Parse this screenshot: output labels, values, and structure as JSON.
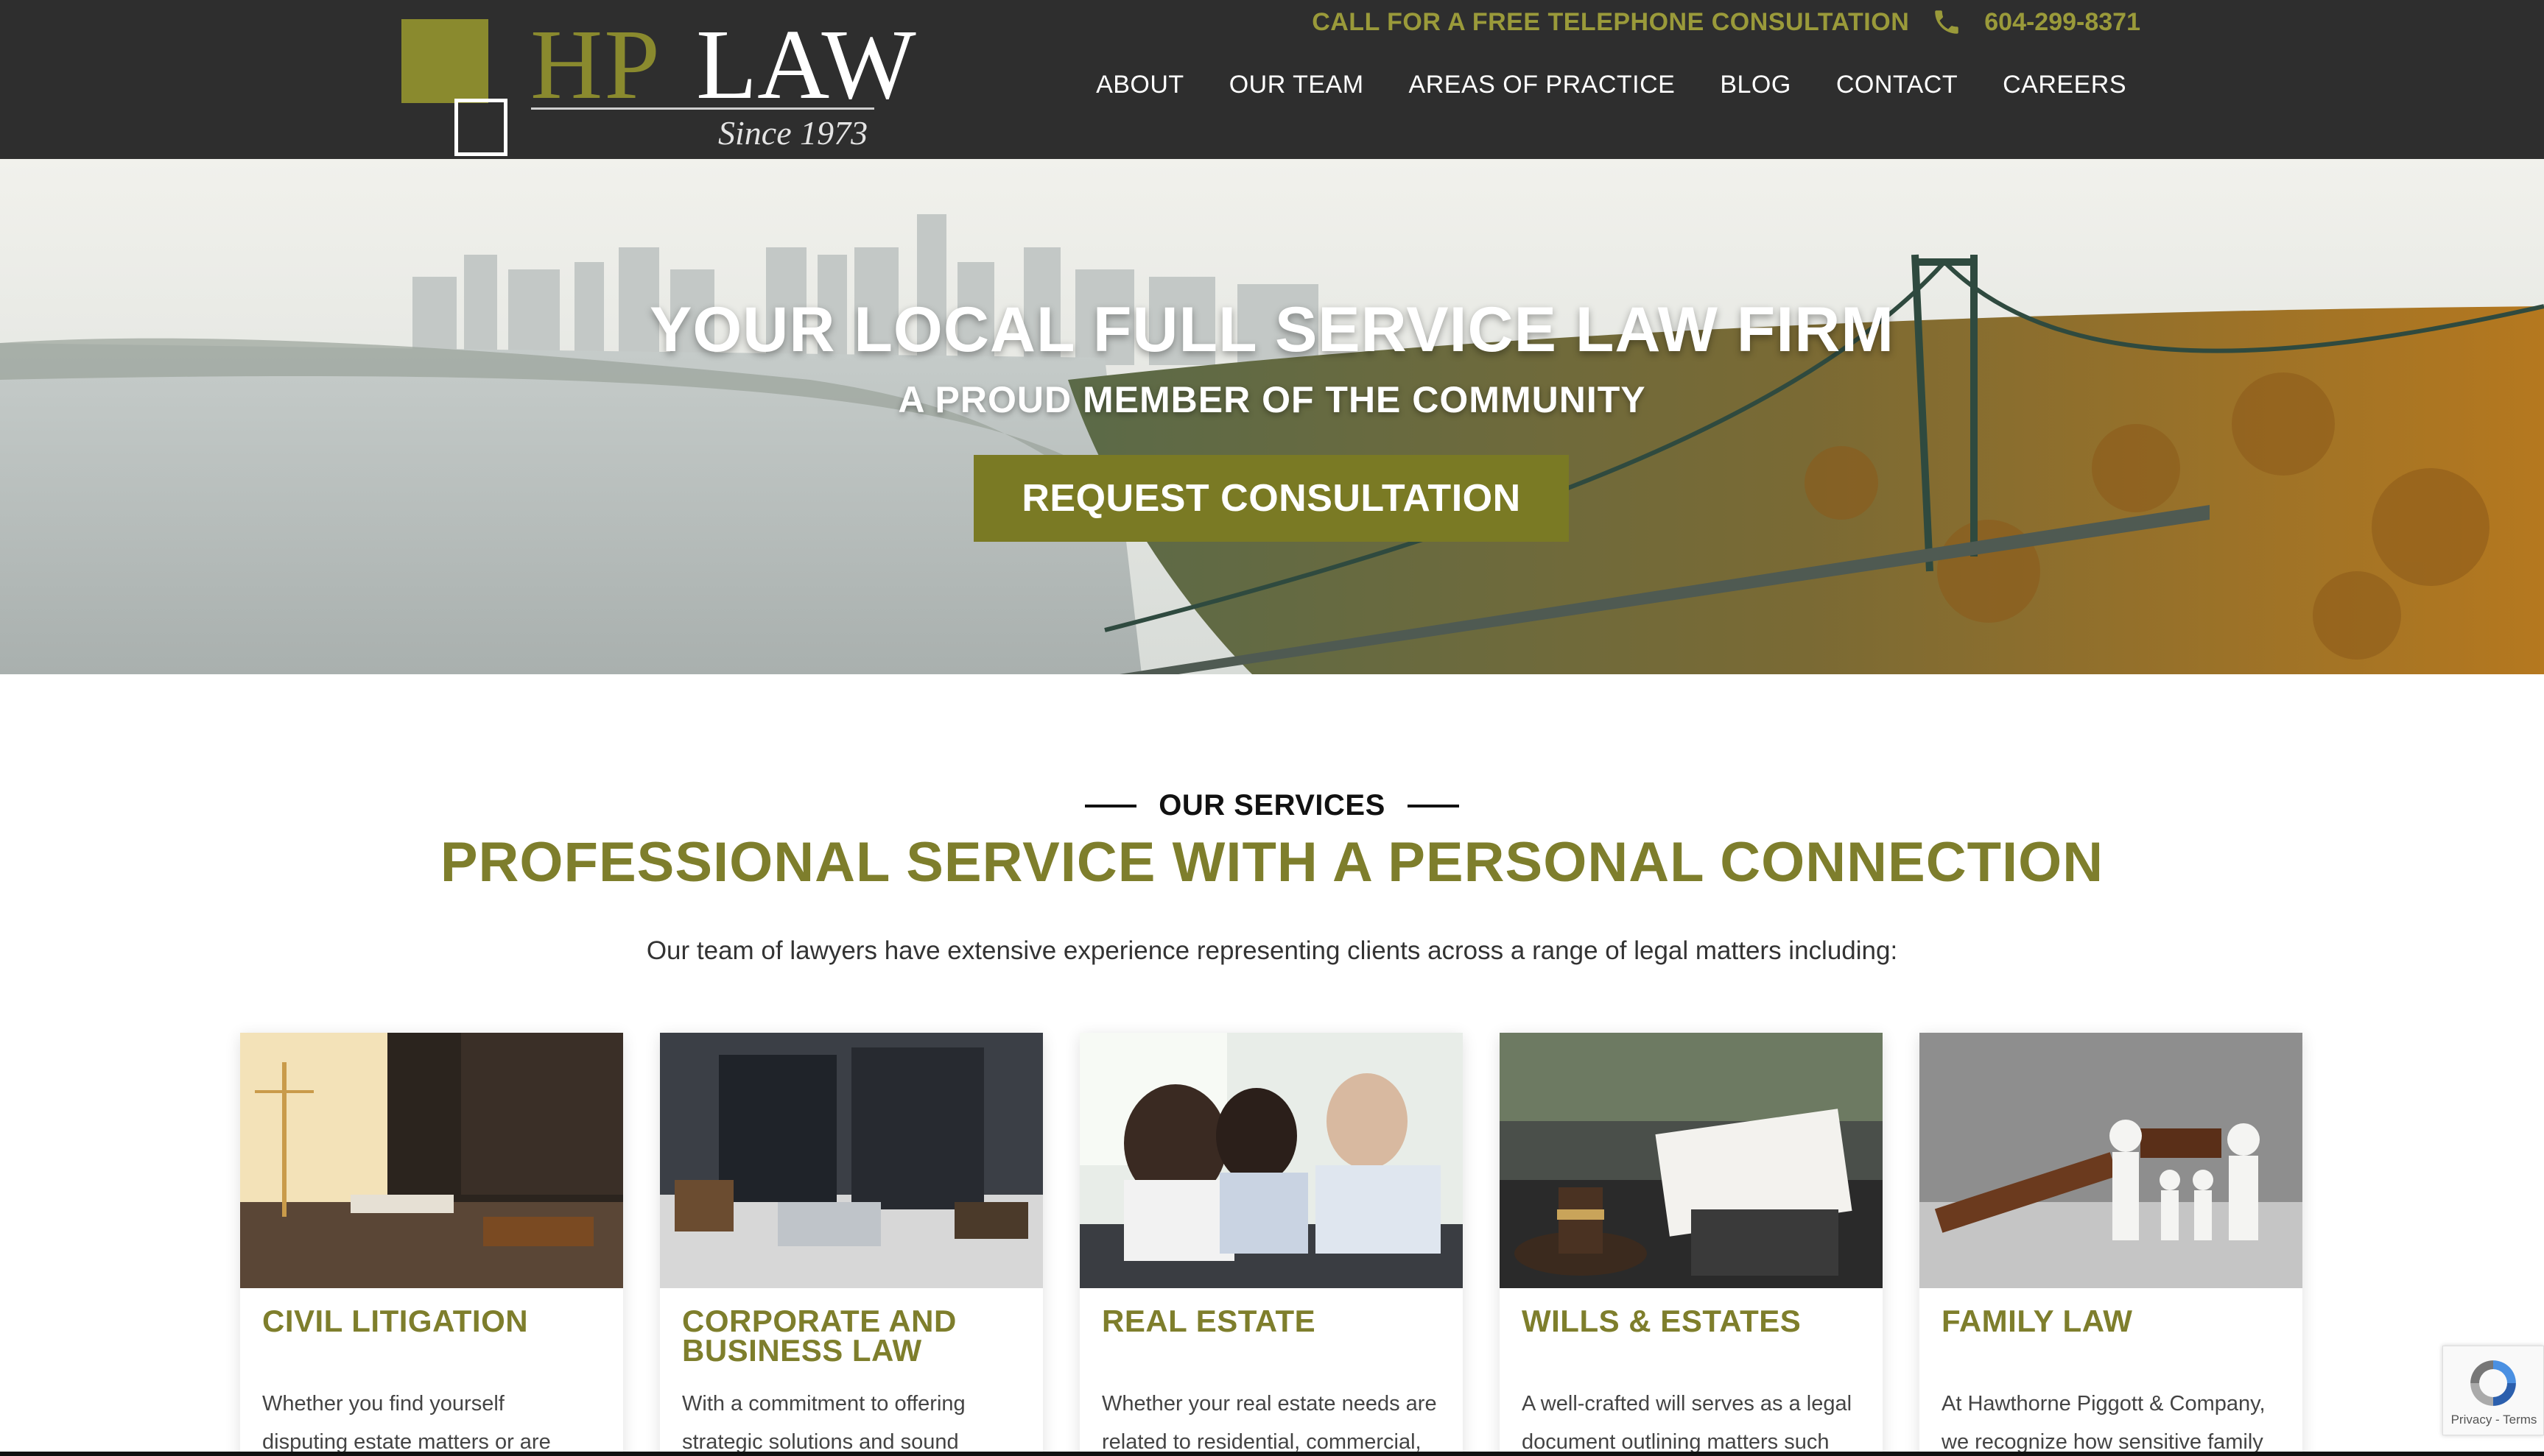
{
  "header": {
    "logo": {
      "hp": "HP",
      "law": "LAW",
      "since": "Since 1973"
    },
    "cta_text": "CALL FOR A FREE TELEPHONE CONSULTATION",
    "phone": "604-299-8371",
    "nav": [
      "ABOUT",
      "OUR TEAM",
      "AREAS OF PRACTICE",
      "BLOG",
      "CONTACT",
      "CAREERS"
    ]
  },
  "hero": {
    "title": "YOUR LOCAL FULL SERVICE LAW FIRM",
    "subtitle": "A PROUD MEMBER OF THE COMMUNITY",
    "button": "REQUEST CONSULTATION"
  },
  "services": {
    "eyebrow": "OUR SERVICES",
    "title": "PROFESSIONAL SERVICE WITH A PERSONAL CONNECTION",
    "intro": "Our team of lawyers have extensive experience representing clients across a range of legal matters including:",
    "cards": [
      {
        "title": "CIVIL LITIGATION",
        "line1": "Whether you find yourself",
        "line2": "disputing estate matters or are"
      },
      {
        "title": "CORPORATE AND BUSINESS LAW",
        "line1": "With a commitment to offering",
        "line2": "strategic solutions and sound"
      },
      {
        "title": "REAL ESTATE",
        "line1": "Whether your real estate needs are",
        "line2": "related to residential, commercial,"
      },
      {
        "title": "WILLS & ESTATES",
        "line1": "A well-crafted will serves as a legal",
        "line2": "document outlining matters such"
      },
      {
        "title": "FAMILY LAW",
        "line1": "At Hawthorne Piggott & Company,",
        "line2": "we recognize how sensitive family"
      }
    ]
  },
  "recaptcha": {
    "links": "Privacy - Terms"
  },
  "colors": {
    "header_bg": "#2e2e2e",
    "accent": "#7e7e2c",
    "button": "#7a7a24"
  }
}
